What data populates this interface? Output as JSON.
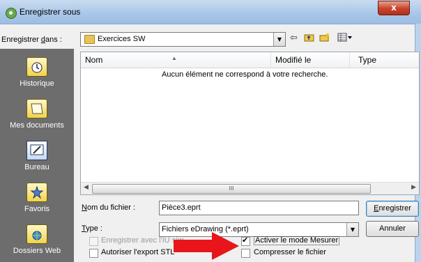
{
  "window": {
    "title": "Enregistrer sous",
    "close_label": "x"
  },
  "save_in": {
    "label_prefix": "Enregistrer ",
    "label_ul": "d",
    "label_suffix": "ans :",
    "value": "Exercices SW"
  },
  "places": [
    {
      "label": "Historique",
      "icon": "history-icon"
    },
    {
      "label": "Mes documents",
      "icon": "my-documents-icon"
    },
    {
      "label": "Bureau",
      "icon": "desktop-icon"
    },
    {
      "label": "Favoris",
      "icon": "favorites-icon"
    },
    {
      "label": "Dossiers Web",
      "icon": "web-folders-icon"
    }
  ],
  "file_list": {
    "columns": [
      "Nom",
      "Modifié le",
      "Type"
    ],
    "empty_message": "Aucun élément ne correspond à votre recherche."
  },
  "filename": {
    "label_ul": "N",
    "label_rest": "om du fichier :",
    "value": "Pièce3.eprt"
  },
  "filetype": {
    "label_ul": "T",
    "label_rest": "ype :",
    "value": "Fichiers eDrawing (*.eprt)"
  },
  "buttons": {
    "save_ul": "E",
    "save_rest": "nregistrer",
    "cancel": "Annuler"
  },
  "options": {
    "save_ui": {
      "label": "Enregistrer avec l'IU sim",
      "checked": false,
      "disabled": true
    },
    "export_stl": {
      "label": "Autoriser l'export STL",
      "checked": false
    },
    "measure_mode": {
      "label": "Activer le mode Mesurer",
      "checked": true
    },
    "compress": {
      "label": "Compresser le fichier",
      "checked": false
    }
  },
  "colors": {
    "annotation_arrow": "#e8161b",
    "places_bar": "#6d6d6d"
  }
}
